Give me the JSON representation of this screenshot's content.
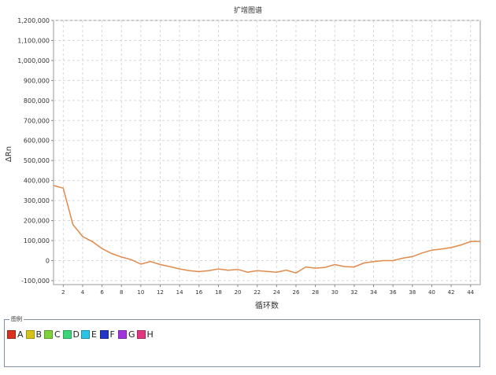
{
  "chart_data": {
    "type": "line",
    "title": "扩增图谱",
    "xlabel": "循环数",
    "ylabel": "ΔRn",
    "xlim": [
      1,
      45
    ],
    "ylim": [
      -120000,
      1200000
    ],
    "x_ticks": [
      2,
      4,
      6,
      8,
      10,
      12,
      14,
      16,
      18,
      20,
      22,
      24,
      26,
      28,
      30,
      32,
      34,
      36,
      38,
      40,
      42,
      44
    ],
    "y_ticks": [
      -100000,
      0,
      100000,
      200000,
      300000,
      400000,
      500000,
      600000,
      700000,
      800000,
      900000,
      1000000,
      1100000,
      1200000
    ],
    "y_tick_labels": [
      "-100,000",
      "0",
      "100,000",
      "200,000",
      "300,000",
      "400,000",
      "500,000",
      "600,000",
      "700,000",
      "800,000",
      "900,000",
      "1,000,000",
      "1,100,000",
      "1,200,000"
    ],
    "grid": true,
    "series": [
      {
        "color": "#e08a4c",
        "x": [
          1,
          2,
          3,
          4,
          5,
          6,
          7,
          8,
          9,
          10,
          11,
          12,
          13,
          14,
          15,
          16,
          17,
          18,
          19,
          20,
          21,
          22,
          23,
          24,
          25,
          26,
          27,
          28,
          29,
          30,
          31,
          32,
          33,
          34,
          35,
          36,
          37,
          38,
          39,
          40,
          41,
          42,
          43,
          44,
          45
        ],
        "values": [
          375000,
          362000,
          180000,
          120000,
          95000,
          60000,
          35000,
          18000,
          5000,
          -18000,
          -5000,
          -20000,
          -30000,
          -42000,
          -50000,
          -55000,
          -50000,
          -42000,
          -48000,
          -44000,
          -58000,
          -50000,
          -54000,
          -58000,
          -48000,
          -62000,
          -32000,
          -38000,
          -34000,
          -20000,
          -30000,
          -32000,
          -12000,
          -5000,
          0,
          0,
          12000,
          20000,
          38000,
          52000,
          58000,
          65000,
          78000,
          95000,
          96000
        ]
      }
    ],
    "legend": {
      "title": "图例",
      "placement": "bottom",
      "items": [
        {
          "label": "A",
          "color": "#d9321f"
        },
        {
          "label": "B",
          "color": "#d6c319"
        },
        {
          "label": "C",
          "color": "#7fd13b"
        },
        {
          "label": "D",
          "color": "#3bd67a"
        },
        {
          "label": "E",
          "color": "#2bc2e3"
        },
        {
          "label": "F",
          "color": "#2235c7"
        },
        {
          "label": "G",
          "color": "#a035e0"
        },
        {
          "label": "H",
          "color": "#e0357f"
        }
      ]
    }
  }
}
